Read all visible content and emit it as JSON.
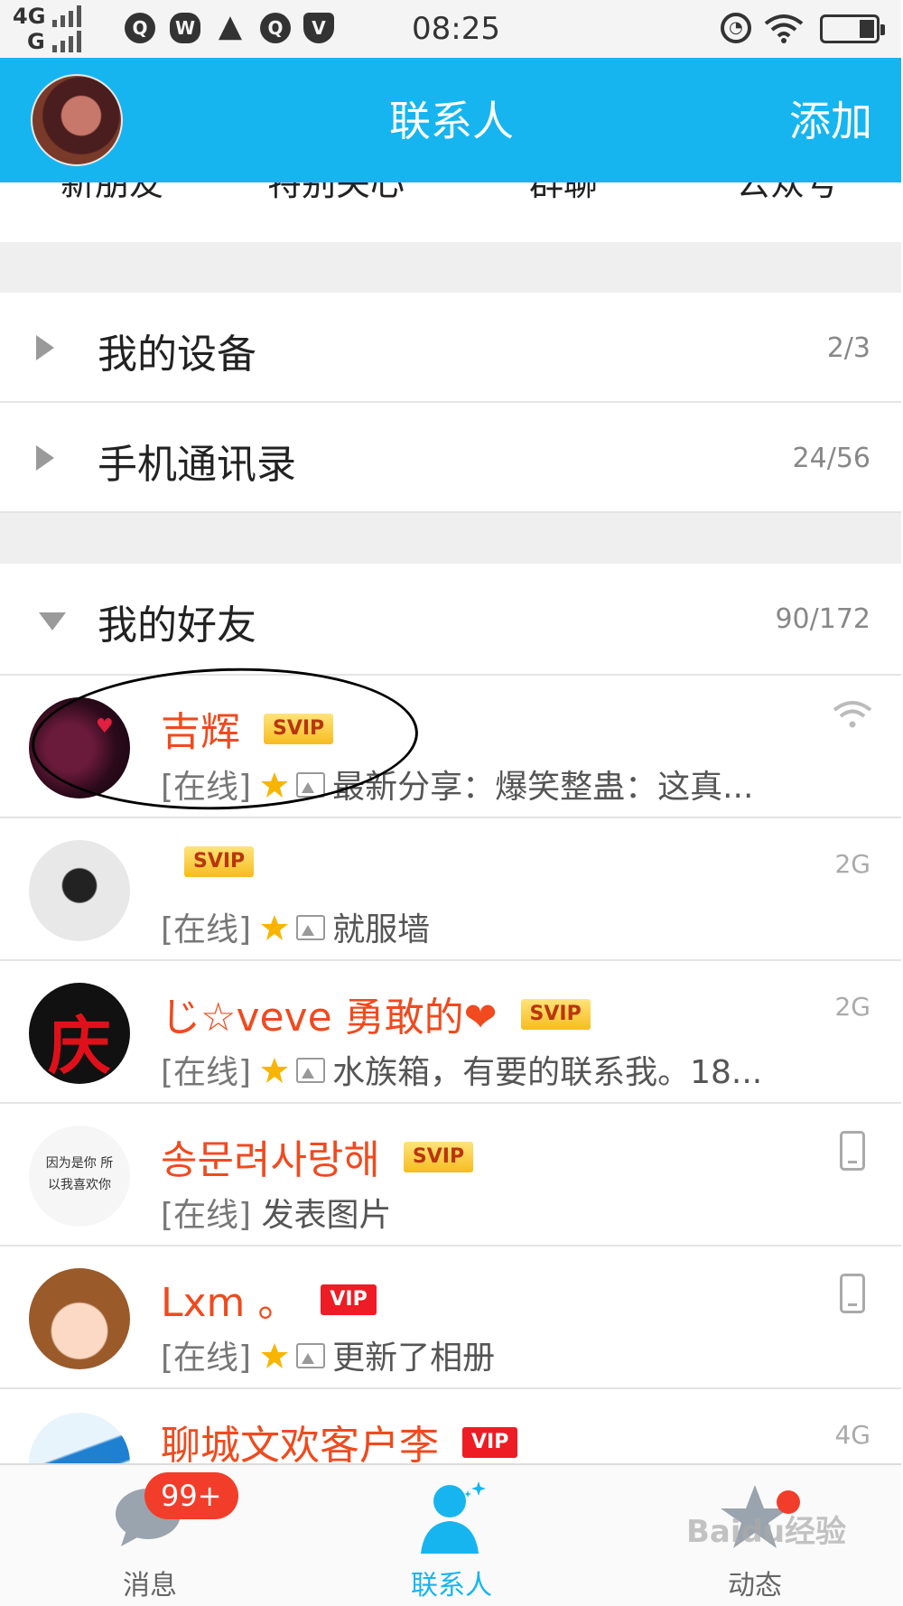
{
  "status_bar": {
    "network_top": "4G",
    "network_bottom": "G",
    "time": "08:25",
    "icons": [
      "qq-icon",
      "wechat-icon",
      "warning-icon",
      "qq-icon",
      "vpn-icon",
      "alarm-icon",
      "wifi-icon",
      "battery-icon"
    ]
  },
  "header": {
    "title": "联系人",
    "add_label": "添加"
  },
  "quick_tabs": [
    "新朋友",
    "特别关心",
    "群聊",
    "公众号"
  ],
  "groups": [
    {
      "label": "我的设备",
      "count": "2/3"
    },
    {
      "label": "手机通讯录",
      "count": "24/56"
    },
    {
      "label": "我的好友",
      "count": "90/172"
    }
  ],
  "friends": [
    {
      "name": "吉辉",
      "badge": "SVIP",
      "prefix": "[在线]",
      "status": "最新分享：爆笑整蛊：这真...",
      "net": "wifi"
    },
    {
      "name": "",
      "badge": "SVIP",
      "prefix": "[在线]",
      "status": "就服墙",
      "net": "2G"
    },
    {
      "name": "じ☆veve 勇敢的❤",
      "badge": "SVIP",
      "prefix": "[在线]",
      "status": "水族箱，有要的联系我。18...",
      "net": "2G"
    },
    {
      "name": "송문려사랑해",
      "badge": "SVIP",
      "prefix": "[在线]",
      "status": "发表图片",
      "net": "phone",
      "avatar_text": "因为是你 所以我喜欢你"
    },
    {
      "name": "Lxm 。",
      "badge": "VIP",
      "prefix": "[在线]",
      "status": "更新了相册",
      "net": "phone"
    },
    {
      "name": "聊城文欢客户李",
      "badge": "VIP",
      "prefix": "",
      "status": "",
      "net": "4G"
    }
  ],
  "tab_bar": {
    "messages_label": "消息",
    "messages_badge": "99+",
    "contacts_label": "联系人",
    "feed_label": "动态"
  },
  "watermark": "Baidu经验",
  "colors": {
    "header_blue": "#16b5f0",
    "name_red": "#f04a1e",
    "vip_red": "#ee1c24",
    "svip_gold": "#f6bc20"
  }
}
